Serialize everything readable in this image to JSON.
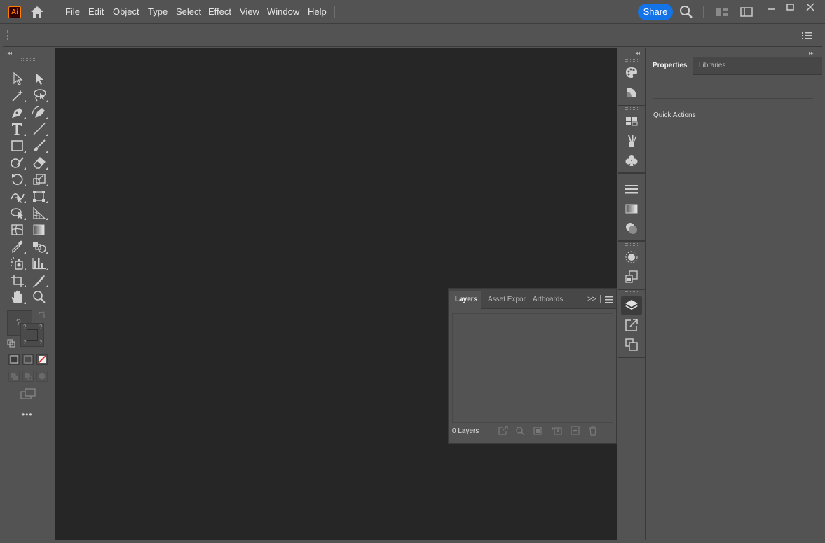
{
  "app": {
    "logo_text": "Ai",
    "accent_color": "#ff7c00"
  },
  "menu": {
    "items": [
      "File",
      "Edit",
      "Object",
      "Type",
      "Select",
      "Effect",
      "View",
      "Window",
      "Help"
    ],
    "share_label": "Share",
    "share_color": "#1473e6"
  },
  "toolbar": {
    "collapse_glyph": "◂◂",
    "tools": [
      [
        "selection-tool",
        "direct-selection-tool"
      ],
      [
        "magic-wand-tool",
        "lasso-tool"
      ],
      [
        "pen-tool",
        "curvature-tool"
      ],
      [
        "type-tool",
        "line-segment-tool"
      ],
      [
        "rectangle-tool",
        "paintbrush-tool"
      ],
      [
        "shaper-tool",
        "eraser-tool"
      ],
      [
        "rotate-tool",
        "scale-tool"
      ],
      [
        "width-tool",
        "free-transform-tool"
      ],
      [
        "shape-builder-tool",
        "perspective-grid-tool"
      ],
      [
        "mesh-tool",
        "gradient-tool"
      ],
      [
        "eyedropper-tool",
        "blend-tool"
      ],
      [
        "symbol-sprayer-tool",
        "column-graph-tool"
      ],
      [
        "artboard-tool",
        "slice-tool"
      ],
      [
        "hand-tool",
        "zoom-tool"
      ]
    ],
    "fill_unknown": "?",
    "more_label": "•••"
  },
  "dock": {
    "collapse_glyph": "◂◂",
    "icons": [
      "color-icon",
      "color-guide-icon",
      "swatches-icon",
      "brushes-icon",
      "symbols-icon",
      "stroke-icon",
      "gradient-icon",
      "transparency-icon",
      "appearance-icon",
      "graphic-styles-icon",
      "layers-icon",
      "asset-export-icon",
      "artboards-icon"
    ]
  },
  "properties": {
    "collapse_glyph": "▸▸",
    "tabs": [
      "Properties",
      "Libraries"
    ],
    "active_tab": 0,
    "quick_actions_label": "Quick Actions"
  },
  "layers": {
    "tabs": [
      "Layers",
      "Asset Export",
      "Artboards"
    ],
    "active_tab": 0,
    "more_glyph": ">>",
    "count_label": "0 Layers"
  }
}
